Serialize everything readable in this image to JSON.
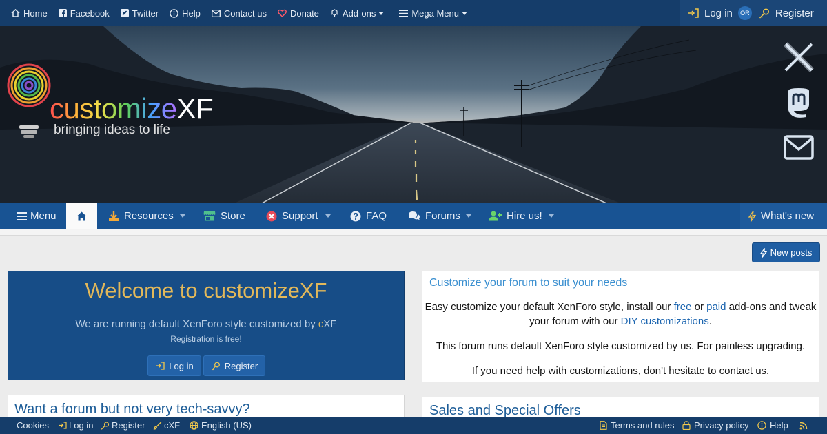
{
  "topbar": {
    "links": [
      {
        "label": "Home",
        "icon": "home-icon"
      },
      {
        "label": "Facebook",
        "icon": "facebook-icon"
      },
      {
        "label": "Twitter",
        "icon": "twitter-icon"
      },
      {
        "label": "Help",
        "icon": "help-icon"
      },
      {
        "label": "Contact us",
        "icon": "envelope-icon"
      },
      {
        "label": "Donate",
        "icon": "heart-icon"
      },
      {
        "label": "Add-ons",
        "icon": "addons-icon"
      },
      {
        "label": "Mega Menu",
        "icon": "hamburger-icon"
      }
    ],
    "login": "Log in",
    "or": "OR",
    "register": "Register"
  },
  "banner": {
    "logo_word_1": "customize",
    "logo_word_2": "XF",
    "tagline": "bringing ideas to life",
    "social": [
      "x-logo-icon",
      "mastodon-icon",
      "envelope-icon"
    ]
  },
  "nav": {
    "menu": "Menu",
    "home": "home-icon",
    "items": [
      {
        "label": "Resources",
        "icon": "download-icon"
      },
      {
        "label": "Store",
        "icon": "store-icon"
      },
      {
        "label": "Support",
        "icon": "support-icon"
      },
      {
        "label": "FAQ",
        "icon": "question-circle-icon"
      },
      {
        "label": "Forums",
        "icon": "comments-icon"
      },
      {
        "label": "Hire us!",
        "icon": "user-plus-icon"
      }
    ],
    "whats_new": "What's new"
  },
  "new_posts": "New posts",
  "welcome": {
    "title": "Welcome to customizeXF",
    "line1_a": "We are running default XenForo style customized by ",
    "line1_c": "c",
    "line1_b": "XF",
    "line2": "Registration is free!",
    "login": "Log in",
    "register": "Register"
  },
  "customize": {
    "title": "Customize your forum to suit your needs",
    "p1_a": "Easy customize your default XenForo style, install our ",
    "p1_free": "free",
    "p1_or": " or ",
    "p1_paid": "paid",
    "p1_b": " add-ons and tweak",
    "p1_c": "your forum with our ",
    "p1_diy": "DIY customizations",
    "p1_d": ".",
    "p2": "This forum runs default XenForo style customized by us. For painless upgrading.",
    "p3": "If you need help with customizations, don't hesitate to contact us."
  },
  "tech_savvy": {
    "title": "Want a forum but not very tech-savvy?"
  },
  "sales": {
    "title": "Sales and Special Offers"
  },
  "footer": {
    "cookies": "Cookies",
    "login": "Log in",
    "register": "Register",
    "cxf": "cXF",
    "language": "English (US)",
    "terms": "Terms and rules",
    "privacy": "Privacy policy",
    "help": "Help"
  },
  "colors": {
    "topbar": "#153d6a",
    "nav": "#185393",
    "welcome_bg": "#174d87",
    "welcome_title": "#e2b85a",
    "link": "#1d66b0",
    "heading": "#1d5d98"
  }
}
